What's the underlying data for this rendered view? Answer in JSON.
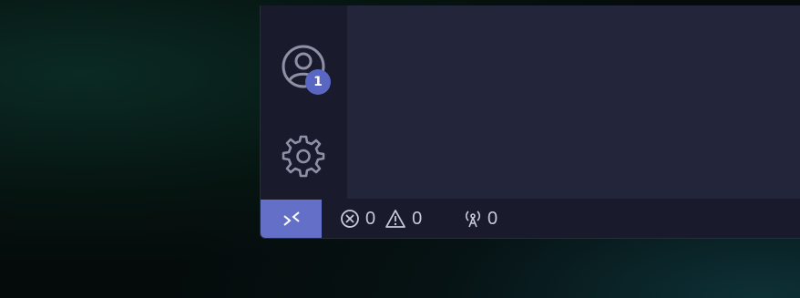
{
  "activity_bar": {
    "accounts": {
      "icon": "account-icon",
      "badge": "1"
    },
    "settings": {
      "icon": "gear-icon"
    }
  },
  "status_bar": {
    "remote": {
      "icon": "remote-icon"
    },
    "problems": {
      "errors_icon": "error-icon",
      "errors": "0",
      "warnings_icon": "warning-icon",
      "warnings": "0"
    },
    "ports": {
      "icon": "broadcast-icon",
      "count": "0"
    }
  },
  "colors": {
    "window_bg": "#191a2c",
    "editor_bg": "#23253a",
    "accent": "#6470c8",
    "badge": "#5a67c2",
    "icon": "#8f90a6",
    "status_text": "#c8c9d8"
  }
}
